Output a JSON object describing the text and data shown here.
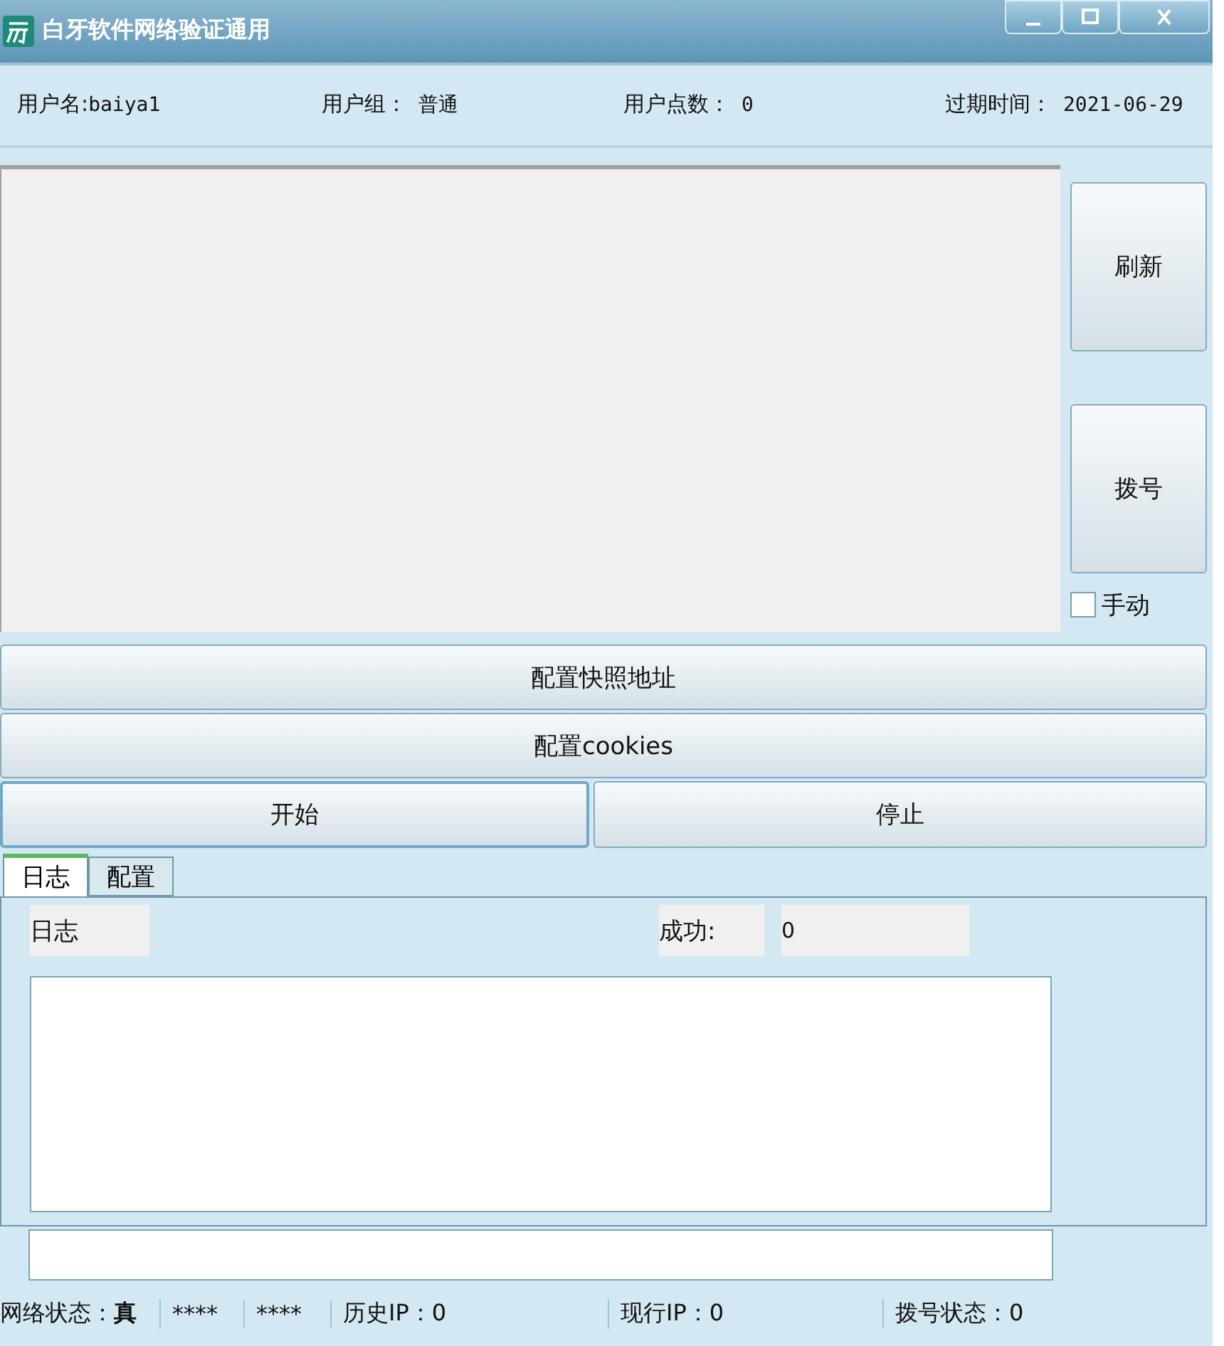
{
  "window": {
    "title": "白牙软件网络验证通用"
  },
  "user_info": [
    {
      "label": "用户名:",
      "value": "baiya1"
    },
    {
      "label": "用户组：",
      "value": "普通"
    },
    {
      "label": "用户点数：",
      "value": "0"
    },
    {
      "label": "过期时间：",
      "value": "2021-06-29"
    }
  ],
  "side_buttons": [
    "刷新",
    "拨号"
  ],
  "manual_checkbox": {
    "label": "手动",
    "checked": false
  },
  "wide_buttons": [
    "配置快照地址",
    "配置cookies"
  ],
  "action_buttons": [
    {
      "label": "开始",
      "focused": true
    },
    {
      "label": "停止",
      "focused": false
    }
  ],
  "tabs": [
    {
      "label": "日志",
      "selected": true
    },
    {
      "label": "配置",
      "selected": false
    }
  ],
  "log_panel": {
    "log_label": "日志",
    "success_label": "成功:",
    "success_value": "0"
  },
  "status_bar": [
    "网络状态：**真**",
    "****",
    "****",
    "历史IP：0",
    "现行IP：0",
    "拨号状态：0"
  ]
}
